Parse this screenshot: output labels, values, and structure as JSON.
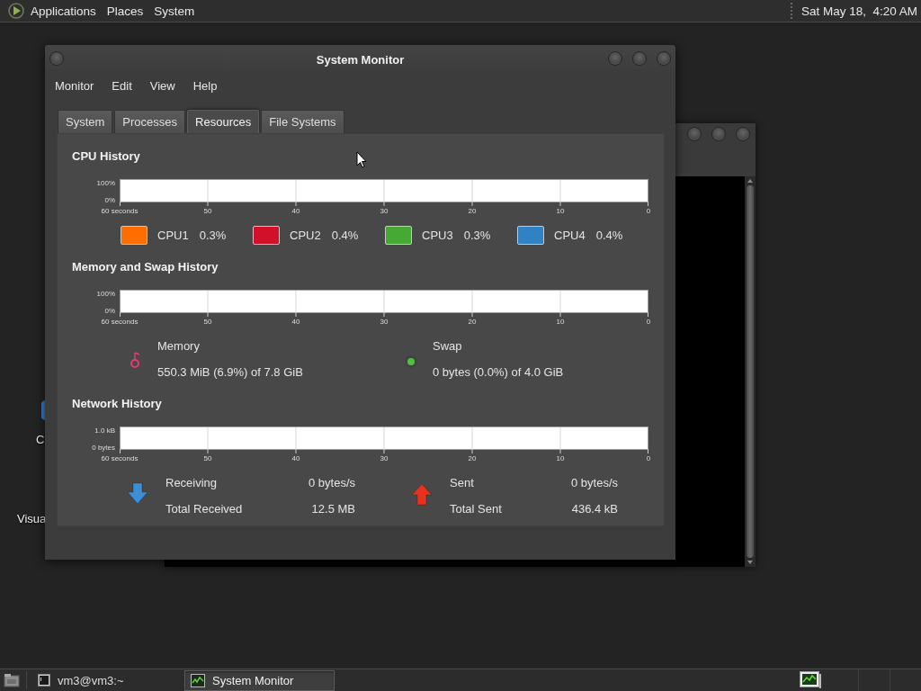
{
  "top_panel": {
    "menus": [
      "Applications",
      "Places",
      "System"
    ],
    "clock": "Sat May 18,  4:20 AM"
  },
  "desktop_icons": [
    {
      "label": "C"
    },
    {
      "label": "Visua"
    }
  ],
  "window": {
    "title": "System Monitor",
    "menu": [
      "Monitor",
      "Edit",
      "View",
      "Help"
    ],
    "tabs": [
      {
        "label": "System",
        "selected": false
      },
      {
        "label": "Processes",
        "selected": false
      },
      {
        "label": "Resources",
        "selected": true
      },
      {
        "label": "File Systems",
        "selected": false
      }
    ],
    "cpu_history": {
      "title": "CPU History",
      "y_labels": [
        "100%",
        "0%"
      ],
      "x_labels": [
        "60 seconds",
        "50",
        "40",
        "30",
        "20",
        "10",
        "0"
      ],
      "legend": [
        {
          "name": "CPU1",
          "value": "0.3%",
          "color": "#ff6d00"
        },
        {
          "name": "CPU2",
          "value": "0.4%",
          "color": "#d21029"
        },
        {
          "name": "CPU3",
          "value": "0.3%",
          "color": "#46a934"
        },
        {
          "name": "CPU4",
          "value": "0.4%",
          "color": "#3182c4"
        }
      ]
    },
    "memory_history": {
      "title": "Memory and Swap History",
      "y_labels": [
        "100%",
        "0%"
      ],
      "x_labels": [
        "60 seconds",
        "50",
        "40",
        "30",
        "20",
        "10",
        "0"
      ],
      "items": [
        {
          "name": "Memory",
          "value": "550.3 MiB (6.9%) of 7.8 GiB",
          "color": "#e53c74"
        },
        {
          "name": "Swap",
          "value": "0 bytes (0.0%) of 4.0 GiB",
          "color": "#4cc23b"
        }
      ]
    },
    "network_history": {
      "title": "Network History",
      "y_labels": [
        "1.0 kB",
        "0 bytes"
      ],
      "x_labels": [
        "60 seconds",
        "50",
        "40",
        "30",
        "20",
        "10",
        "0"
      ],
      "items": [
        {
          "kind": "receiving",
          "color": "#3c8fd6",
          "rows": [
            {
              "label": "Receiving",
              "value": "0 bytes/s"
            },
            {
              "label": "Total Received",
              "value": "12.5 MB"
            }
          ]
        },
        {
          "kind": "sent",
          "color": "#e8321e",
          "rows": [
            {
              "label": "Sent",
              "value": "0 bytes/s"
            },
            {
              "label": "Total Sent",
              "value": "436.4 kB"
            }
          ]
        }
      ]
    }
  },
  "taskbar": {
    "tasks": [
      {
        "kind": "terminal",
        "label": "vm3@vm3:~",
        "selected": false
      },
      {
        "kind": "monitor",
        "label": "System Monitor",
        "selected": true
      }
    ]
  }
}
